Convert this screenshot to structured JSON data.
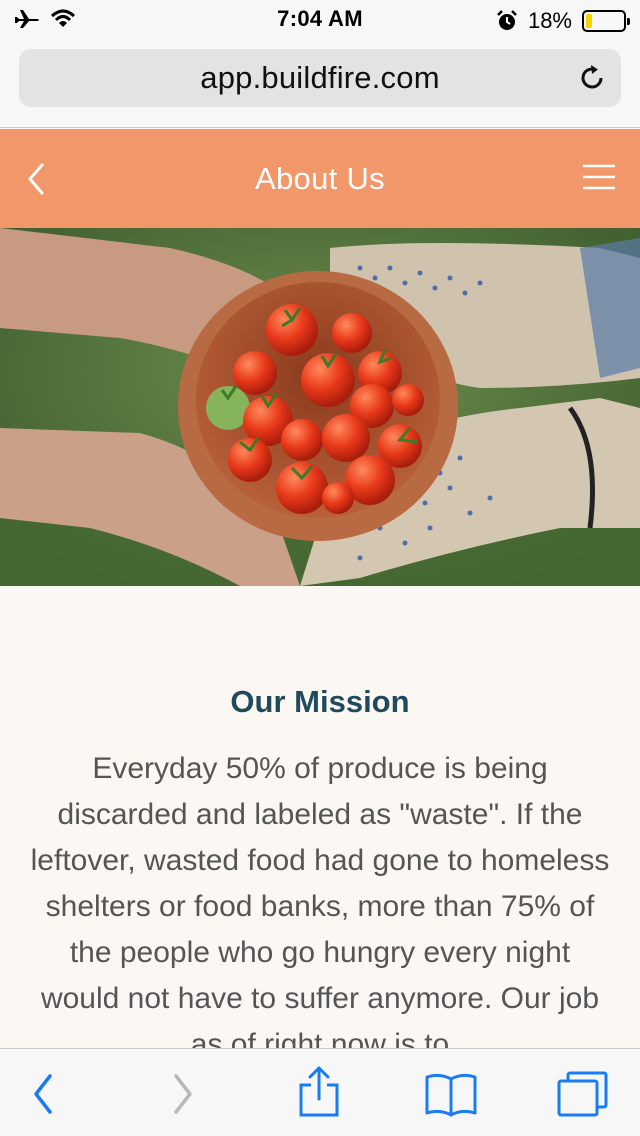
{
  "status_bar": {
    "time": "7:04 AM",
    "battery_percent": "18%",
    "battery_level": 0.18,
    "icons": [
      "airplane-icon",
      "wifi-icon",
      "alarm-icon",
      "battery-icon"
    ]
  },
  "browser": {
    "url": "app.buildfire.com",
    "reload_icon": "reload-icon"
  },
  "app_header": {
    "title": "About Us",
    "background_color": "#f2976a",
    "back_icon": "chevron-left-icon",
    "menu_icon": "hamburger-menu-icon"
  },
  "hero": {
    "image": "hands-holding-bowl-of-tomatoes"
  },
  "content": {
    "heading": "Our Mission",
    "heading_color": "#1f4a5c",
    "body": "Everyday 50% of produce is being discarded and labeled as \"waste\". If the leftover, wasted food had gone to homeless shelters or food banks, more than 75% of the people who go hungry every night would not have to suffer anymore. Our job as of right now is to"
  },
  "toolbar": {
    "accent_color": "#1a7cf5",
    "buttons": [
      "back-icon",
      "forward-icon",
      "share-icon",
      "bookmarks-icon",
      "tabs-icon"
    ]
  }
}
